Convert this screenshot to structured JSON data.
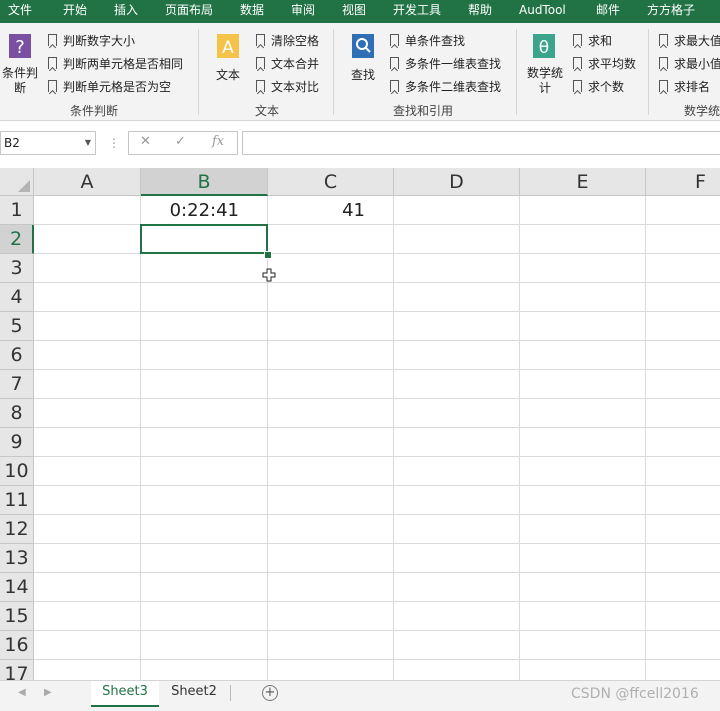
{
  "menu": [
    "文件",
    "开始",
    "插入",
    "页面布局",
    "数据",
    "审阅",
    "视图",
    "开发工具",
    "帮助",
    "AudTool",
    "邮件",
    "方方格子"
  ],
  "ribbon": {
    "groups": [
      {
        "name": "条件判断",
        "big_button": {
          "label": "条件判\n断",
          "icon": "question-icon"
        },
        "items": [
          "判断数字大小",
          "判断两单元格是否相同",
          "判断单元格是否为空"
        ]
      },
      {
        "name": "文本",
        "big_button": {
          "label": "文本",
          "icon": "text-a-icon"
        },
        "items": [
          "清除空格",
          "文本合并",
          "文本对比"
        ]
      },
      {
        "name": "查找和引用",
        "big_button": {
          "label": "查找",
          "icon": "search-icon"
        },
        "items": [
          "单条件查找",
          "多条件一维表查找",
          "多条件二维表查找"
        ]
      },
      {
        "name": "数学统",
        "big_button": {
          "label": "数学统\n计",
          "icon": "theta-icon"
        },
        "items": [
          "求和",
          "求平均数",
          "求个数",
          "求最大值",
          "求最小值",
          "求排名"
        ]
      }
    ]
  },
  "formula_bar": {
    "name_box": "B2",
    "cancel": "✕",
    "confirm": "✓",
    "fx": "fx",
    "formula": ""
  },
  "sheet": {
    "columns": [
      "A",
      "B",
      "C",
      "D",
      "E",
      "F"
    ],
    "rows": [
      "1",
      "2",
      "3",
      "4",
      "5",
      "6",
      "7",
      "8",
      "9",
      "10",
      "11",
      "12",
      "13",
      "14",
      "15",
      "16",
      "17"
    ],
    "cells": {
      "B1": "0:22:41",
      "C1": "41"
    },
    "selected": "B2"
  },
  "tabs": [
    "Sheet3",
    "Sheet2"
  ],
  "active_tab": "Sheet3",
  "watermark": "CSDN @ffcell2016",
  "colors": {
    "accent": "#217346"
  }
}
